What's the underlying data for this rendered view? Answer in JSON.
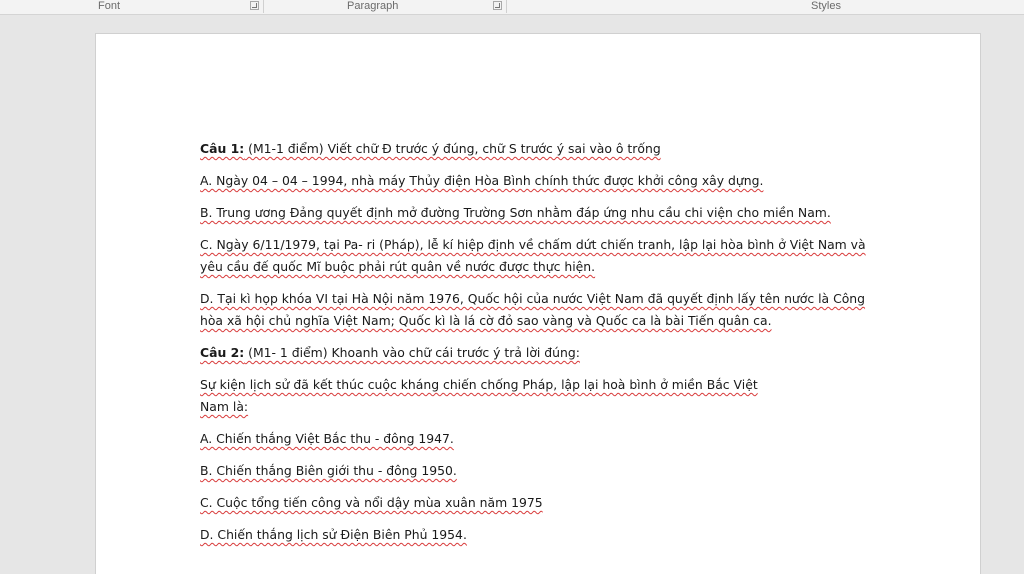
{
  "ribbon": {
    "font_label": "Font",
    "paragraph_label": "Paragraph",
    "styles_label": "Styles"
  },
  "document": {
    "paragraphs": [
      {
        "bold": "Câu 1:",
        "text": " (M1-1 điểm) Viết chữ Đ trước ý đúng, chữ S trước ý sai vào ô trống"
      },
      {
        "bold": "",
        "text": "A. Ngày 04 – 04 – 1994, nhà máy Thủy điện Hòa Bình chính thức được khởi công xây dựng."
      },
      {
        "bold": "",
        "text": "B. Trung ương Đảng quyết định mở đường Trường Sơn nhằm đáp ứng nhu cầu chi viện cho miền Nam."
      },
      {
        "bold": "",
        "text": "C. Ngày 6/11/1979, tại Pa- ri (Pháp), lễ kí hiệp định về chấm dứt chiến tranh, lập lại hòa bình ở Việt Nam và yêu cầu đế quốc Mĩ buộc phải rút quân về nước được thực hiện."
      },
      {
        "bold": "",
        "text": "D. Tại kì họp khóa VI tại Hà Nội năm 1976, Quốc hội của nước Việt Nam đã quyết định lấy tên nước là Công hòa xã hội chủ nghĩa Việt Nam; Quốc kì là lá cờ đỏ sao vàng và Quốc ca là bài Tiến quân ca."
      },
      {
        "bold": "Câu 2:",
        "text": " (M1- 1 điểm) Khoanh vào chữ cái trước ý trả lời đúng:"
      },
      {
        "bold": "",
        "text": "Sự kiện lịch sử đã kết thúc cuộc kháng chiến chống Pháp, lập lại hoà bình ở miền Bắc Việt Nam là:"
      },
      {
        "bold": "",
        "text": "A. Chiến thắng Việt Bắc thu - đông 1947."
      },
      {
        "bold": "",
        "text": "B. Chiến thắng Biên giới thu - đông 1950."
      },
      {
        "bold": "",
        "text": "C. Cuộc tổng tiến công và nổi dậy mùa xuân năm 1975"
      },
      {
        "bold": "",
        "text": "D. Chiến thắng lịch sử Điện Biên Phủ 1954."
      }
    ]
  }
}
